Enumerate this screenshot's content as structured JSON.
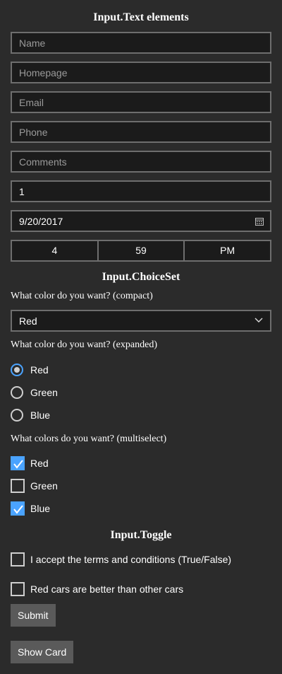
{
  "text_section": {
    "heading": "Input.Text elements",
    "name_placeholder": "Name",
    "homepage_placeholder": "Homepage",
    "email_placeholder": "Email",
    "phone_placeholder": "Phone",
    "comments_placeholder": "Comments",
    "number_value": "1",
    "date_value": "9/20/2017",
    "time": {
      "hour": "4",
      "minute": "59",
      "ampm": "PM"
    }
  },
  "choice_section": {
    "heading": "Input.ChoiceSet",
    "compact_label": "What color do you want? (compact)",
    "compact_selected": "Red",
    "expanded_label": "What color do you want? (expanded)",
    "expanded_options": [
      "Red",
      "Green",
      "Blue"
    ],
    "expanded_selected": "Red",
    "multi_label": "What colors do you want? (multiselect)",
    "multi_options": [
      "Red",
      "Green",
      "Blue"
    ],
    "multi_checked": [
      "Red",
      "Blue"
    ]
  },
  "toggle_section": {
    "heading": "Input.Toggle",
    "terms_label": "I accept the terms and conditions (True/False)",
    "cars_label": "Red cars are better than other cars"
  },
  "actions": {
    "submit_label": "Submit",
    "show_card_label": "Show Card"
  },
  "colors": {
    "background": "#2b2b2b",
    "field_background": "#1b1b1b",
    "border": "#6e6e6e",
    "accent": "#4aa3ff"
  }
}
